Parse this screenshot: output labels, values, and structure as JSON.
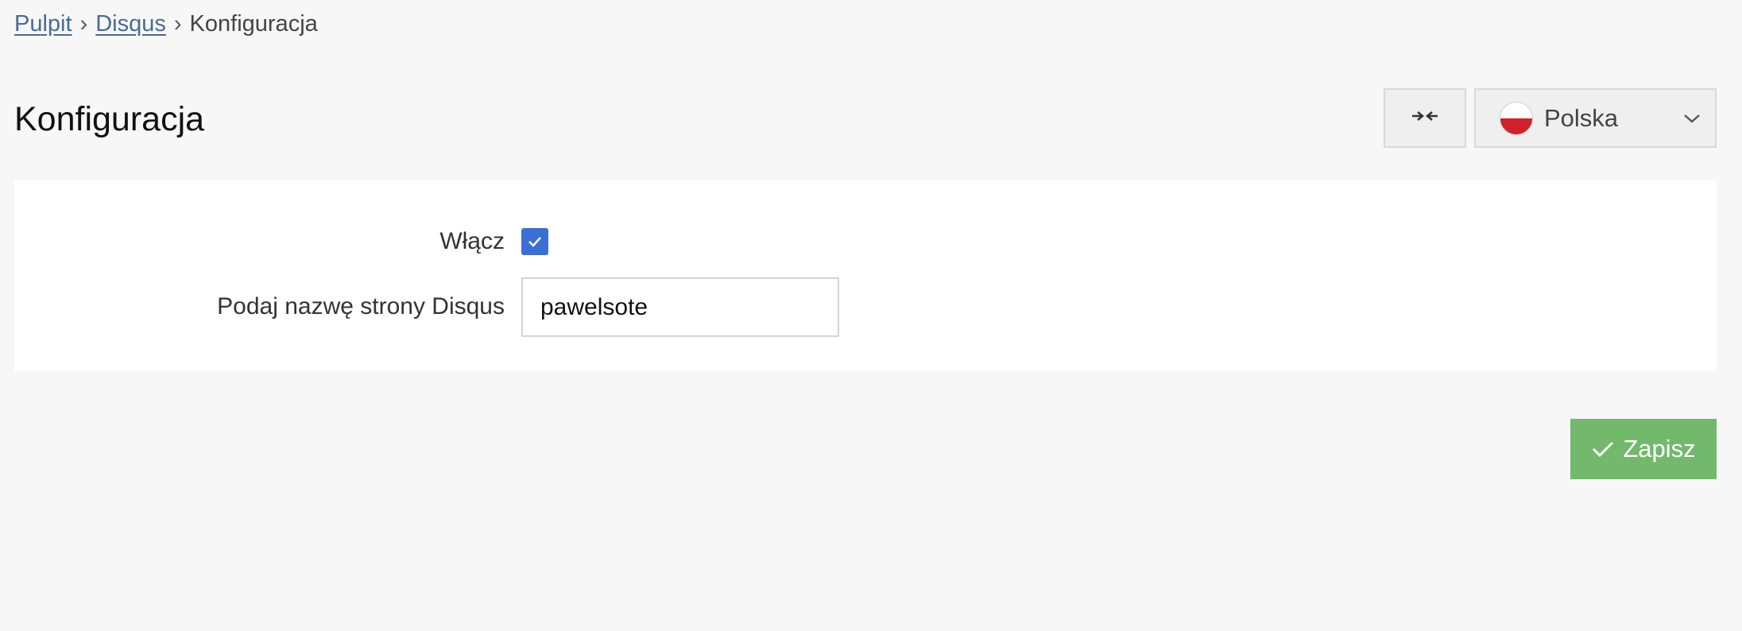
{
  "breadcrumb": {
    "items": [
      {
        "label": "Pulpit"
      },
      {
        "label": "Disqus"
      }
    ],
    "separator": "›",
    "current": "Konfiguracja"
  },
  "header": {
    "title": "Konfiguracja",
    "collapse_icon": "collapse-arrows-icon",
    "language": {
      "selected": "Polska",
      "flag_icon": "poland-flag-icon",
      "chevron_icon": "chevron-down-icon"
    }
  },
  "form": {
    "enable": {
      "label": "Włącz",
      "checked": true
    },
    "site_name": {
      "label": "Podaj nazwę strony Disqus",
      "value": "pawelsote"
    }
  },
  "actions": {
    "save_label": "Zapisz",
    "save_icon": "checkmark-icon"
  },
  "colors": {
    "link": "#4a6a96",
    "checkbox": "#3b6fd6",
    "save_button": "#72b96b",
    "flag_red": "#d0202a"
  }
}
